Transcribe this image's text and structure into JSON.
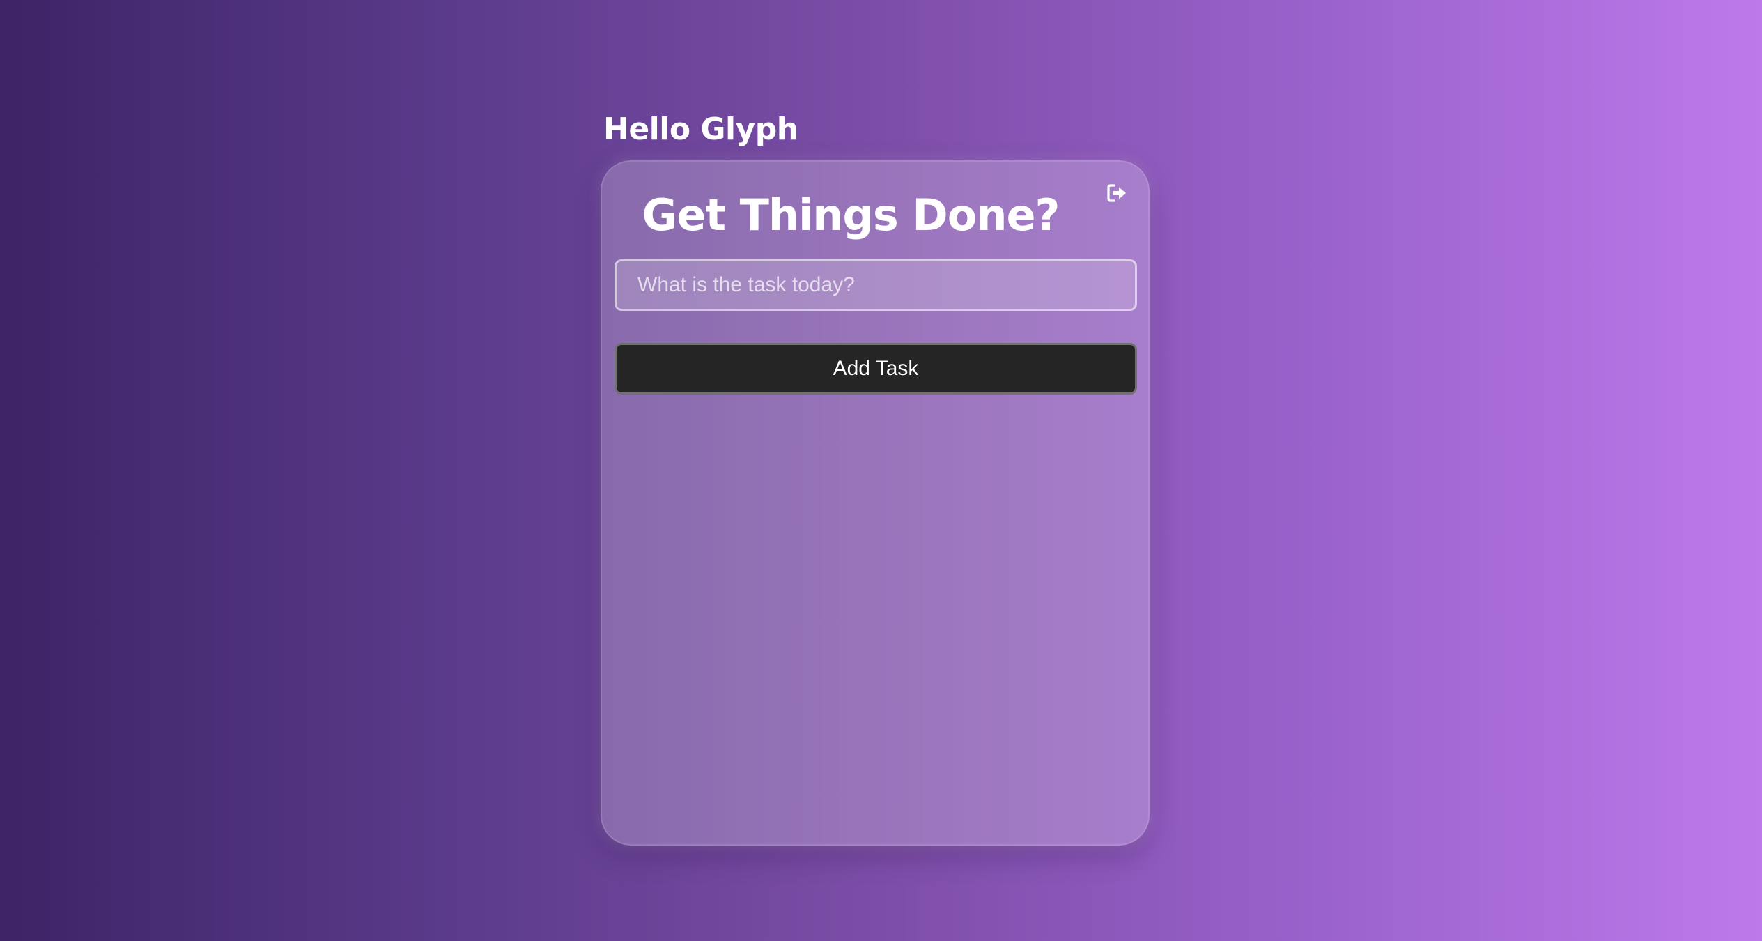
{
  "header": {
    "greeting": "Hello Glyph"
  },
  "card": {
    "title": "Get Things Done?",
    "logout_icon": "sign-out-icon",
    "task_input": {
      "value": "",
      "placeholder": "What is the task today?"
    },
    "add_button_label": "Add Task"
  },
  "colors": {
    "background_start": "#3c2466",
    "background_end": "#bd79ea",
    "button_bg": "#252525",
    "text": "#ffffff"
  }
}
